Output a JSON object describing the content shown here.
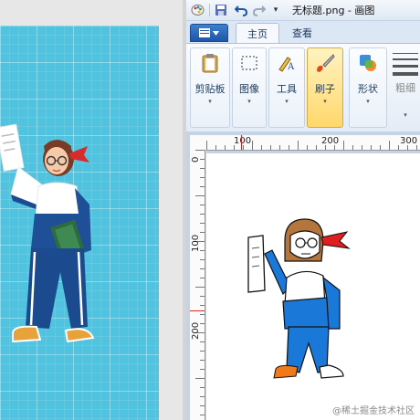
{
  "window": {
    "title": "无标题.png - 画图",
    "quick_access": [
      "save-icon",
      "undo-icon",
      "redo-icon",
      "customize-arrow-icon"
    ],
    "more_glyph": "▾"
  },
  "tabs": [
    {
      "label": "主页",
      "active": true
    },
    {
      "label": "查看",
      "active": false
    }
  ],
  "ribbon": {
    "groups": [
      {
        "label": "剪贴板",
        "icon": "clipboard-icon",
        "arrow": "▾"
      },
      {
        "label": "图像",
        "icon": "select-icon",
        "arrow": "▾"
      },
      {
        "label": "工具",
        "icon": "tools-icon",
        "arrow": "▾"
      },
      {
        "label": "刷子",
        "icon": "brush-icon",
        "arrow": "▾",
        "active": true
      },
      {
        "label": "形状",
        "icon": "shapes-icon",
        "arrow": "▾"
      },
      {
        "label": "粗细",
        "icon": "size-icon",
        "arrow": "▾"
      }
    ]
  },
  "ruler": {
    "horizontal_labels": [
      "100",
      "200",
      "300"
    ],
    "vertical_labels": [
      "0",
      "100",
      "200"
    ]
  },
  "colors": {
    "reference_bg": "#4fc3df",
    "ribbon_active": "#ffd86b",
    "accent": "#1d56a8",
    "ruler_cursor": "#e02020"
  },
  "watermark": "@稀土掘金技术社区"
}
